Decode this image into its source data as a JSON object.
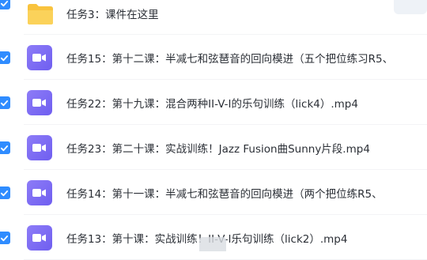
{
  "files": [
    {
      "name": "任务3：课件在这里",
      "type": "folder",
      "checked": true
    },
    {
      "name": "任务15：第十二课：半减七和弦琶音的回向模进（五个把位练习R5、",
      "type": "video",
      "checked": true
    },
    {
      "name": "任务22：第十九课：混合两种II-V-I的乐句训练（lick4）.mp4",
      "type": "video",
      "checked": true
    },
    {
      "name": "任务23：第二十课：实战训练！Jazz Fusion曲Sunny片段.mp4",
      "type": "video",
      "checked": true
    },
    {
      "name": "任务14：第十一课：半减七和弦琶音的回向模进（两个把位练R5、",
      "type": "video",
      "checked": true
    },
    {
      "name": "任务13：第十课：实战训练！II-V-I乐句训练（lick2）.mp4",
      "type": "video",
      "checked": true
    }
  ],
  "colors": {
    "checkbox": "#2f8cff",
    "folder": "#f9c33d",
    "video_icon": "#7b6cf5"
  }
}
